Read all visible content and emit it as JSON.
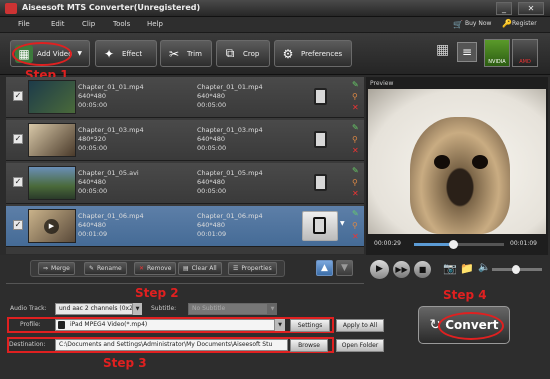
{
  "app": {
    "title": "Aiseesoft MTS Converter(Unregistered)"
  },
  "menu": [
    "File",
    "Edit",
    "Clip",
    "Tools",
    "Help"
  ],
  "links": {
    "buy": "Buy Now",
    "register": "Register"
  },
  "toolbar": {
    "add_video": "Add Video",
    "effect": "Effect",
    "trim": "Trim",
    "crop": "Crop",
    "preferences": "Preferences"
  },
  "steps": {
    "s1": "Step 1",
    "s2": "Step 2",
    "s3": "Step 3",
    "s4": "Step 4"
  },
  "files": [
    {
      "name": "Chapter_01_01.mp4",
      "dim": "640*480",
      "dur": "00:05:00",
      "out": "Chapter_01_01.mp4",
      "odim": "640*480",
      "odur": "00:05:00"
    },
    {
      "name": "Chapter_01_03.mp4",
      "dim": "480*320",
      "dur": "00:05:00",
      "out": "Chapter_01_03.mp4",
      "odim": "640*480",
      "odur": "00:05:00"
    },
    {
      "name": "Chapter_01_05.avi",
      "dim": "640*480",
      "dur": "00:05:00",
      "out": "Chapter_01_05.mp4",
      "odim": "640*480",
      "odur": "00:05:00"
    },
    {
      "name": "Chapter_01_06.mp4",
      "dim": "640*480",
      "dur": "00:01:09",
      "out": "Chapter_01_06.mp4",
      "odim": "640*480",
      "odur": "00:01:09"
    }
  ],
  "preview": {
    "label": "Preview",
    "time_current": "00:00:29",
    "time_total": "00:01:09",
    "progress": 0.42
  },
  "list_buttons": {
    "merge": "Merge",
    "rename": "Rename",
    "remove": "Remove",
    "clear_all": "Clear All",
    "properties": "Properties"
  },
  "settings": {
    "audio_track_label": "Audio Track:",
    "audio_track": "und aac 2 channels (0x2",
    "subtitle_label": "Subtitle:",
    "subtitle": "No Subtitle",
    "profile_label": "Profile:",
    "profile": "iPad MPEG4 Video(*.mp4)",
    "settings_btn": "Settings",
    "apply_all": "Apply to All",
    "destination_label": "Destination:",
    "destination": "C:\\Documents and Settings\\Administrator\\My Documents\\Aiseesoft Stu",
    "browse": "Browse",
    "open_folder": "Open Folder"
  },
  "convert": "Convert",
  "colors": {
    "accent": "#4a6f9a",
    "step_red": "#e02020",
    "convert_green": "#2f7f3a"
  }
}
